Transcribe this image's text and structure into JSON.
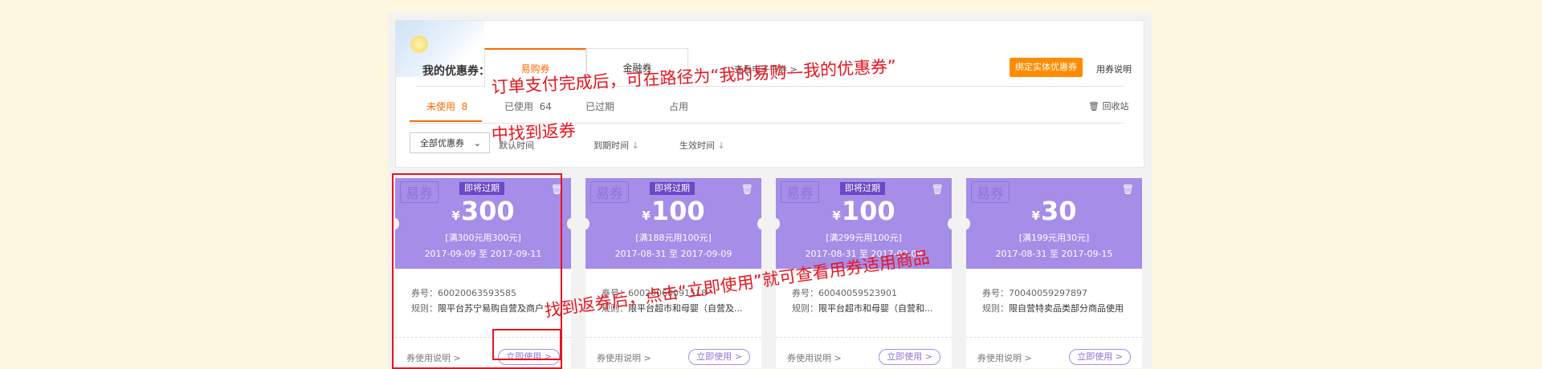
{
  "header": {
    "title": "我的优惠券：",
    "tabs": [
      {
        "label": "易购券",
        "active": true
      },
      {
        "label": "金融券",
        "active": false
      }
    ],
    "ebook_link": "查看电子书券 >",
    "bind_button": "绑定实体优惠券",
    "rules_link": "用券说明"
  },
  "status_tabs": [
    {
      "label": "未使用",
      "count": "8",
      "active": true
    },
    {
      "label": "已使用",
      "count": "64",
      "active": false
    },
    {
      "label": "已过期",
      "count": "",
      "active": false
    },
    {
      "label": "占用",
      "count": "",
      "active": false
    }
  ],
  "recycle_label": "回收站",
  "filter": {
    "select_value": "全部优惠券",
    "sorts": [
      "默认时间",
      "到期时间",
      "生效时间"
    ]
  },
  "coupons": [
    {
      "badge": "易券",
      "tag": "即将过期",
      "yen": "¥",
      "amount": "300",
      "condition": "[满300元用300元]",
      "dates": "2017-09-09 至 2017-09-11",
      "code": "券号：60020063593585",
      "rule_label": "规则：",
      "rule": "限平台苏宁易购自营及商户",
      "desc_link": "券使用说明 >",
      "use_button": "立即使用 >"
    },
    {
      "badge": "易券",
      "tag": "即将过期",
      "yen": "¥",
      "amount": "100",
      "condition": "[满188元用100元]",
      "dates": "2017-08-31 至 2017-09-09",
      "code": "券号：60020060091518",
      "rule_label": "规则：",
      "rule": "限平台超市和母婴（自营及...",
      "desc_link": "券使用说明 >",
      "use_button": "立即使用 >"
    },
    {
      "badge": "易券",
      "tag": "即将过期",
      "yen": "¥",
      "amount": "100",
      "condition": "[满299元用100元]",
      "dates": "2017-08-31 至 2017-09-09",
      "code": "券号：60040059523901",
      "rule_label": "规则：",
      "rule": "限平台超市和母婴（自营和...",
      "desc_link": "券使用说明 >",
      "use_button": "立即使用 >"
    },
    {
      "badge": "易券",
      "tag": "",
      "yen": "¥",
      "amount": "30",
      "condition": "[满199元用30元]",
      "dates": "2017-08-31 至 2017-09-15",
      "code": "券号：70040059297897",
      "rule_label": "规则：",
      "rule": "限自营特卖品类部分商品使用",
      "desc_link": "券使用说明 >",
      "use_button": "立即使用 >"
    }
  ],
  "annotations": {
    "line1": "订单支付完成后，可在路径为“我的易购—我的优惠券”",
    "line2": "中找到返券",
    "line3": "找到返券后，点击“立即使用”就可查看用券适用商品"
  },
  "colors": {
    "accent": "#ff6a00",
    "coupon_purple": "#a58de8",
    "annotation_red": "#e8141e",
    "page_bg": "#fdf7df"
  }
}
